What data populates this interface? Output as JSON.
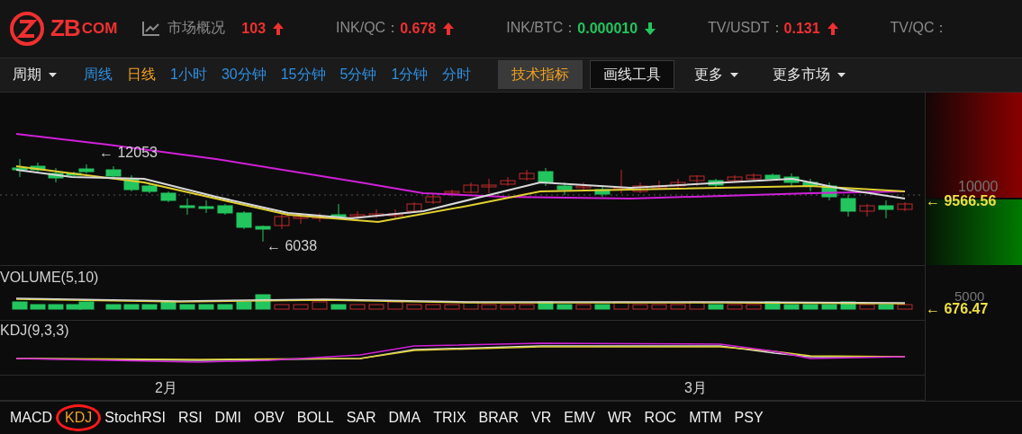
{
  "header": {
    "logo": {
      "mark": "ZB",
      "suffix": "COM"
    },
    "overview": {
      "label": "市场概况",
      "value": "103",
      "rising": true
    },
    "tickers": [
      {
        "pair": "INK/QC：",
        "price": "0.678",
        "rising": true
      },
      {
        "pair": "INK/BTC：",
        "price": "0.000010",
        "rising": false
      },
      {
        "pair": "TV/USDT：",
        "price": "0.131",
        "rising": true
      },
      {
        "pair": "TV/QC："
      }
    ]
  },
  "toolbar": {
    "period_menu": "周期",
    "intervals": [
      {
        "label": "周线",
        "selected": false
      },
      {
        "label": "日线",
        "selected": true
      },
      {
        "label": "1小时",
        "selected": false
      },
      {
        "label": "30分钟",
        "selected": false
      },
      {
        "label": "15分钟",
        "selected": false
      },
      {
        "label": "5分钟",
        "selected": false
      },
      {
        "label": "1分钟",
        "selected": false
      },
      {
        "label": "分时",
        "selected": false
      }
    ],
    "buttons": [
      {
        "label": "技术指标",
        "selected": true
      },
      {
        "label": "画线工具",
        "selected": false
      }
    ],
    "menus": [
      "更多",
      "更多市场"
    ]
  },
  "chart": {
    "high_label": "← 12053",
    "low_label": "← 6038",
    "price_axis": "10000",
    "current_price": "← 9566.56",
    "volume_title": "VOLUME(5,10)",
    "volume_axis": "5000",
    "current_volume": "← 676.47",
    "kdj_title": "KDJ(9,3,3)",
    "months": [
      "2月",
      "3月"
    ]
  },
  "indicators": [
    {
      "label": "MACD",
      "selected": false,
      "circled": false
    },
    {
      "label": "KDJ",
      "selected": true,
      "circled": true
    },
    {
      "label": "StochRSI",
      "selected": false,
      "circled": false
    },
    {
      "label": "RSI",
      "selected": false,
      "circled": false
    },
    {
      "label": "DMI",
      "selected": false,
      "circled": false
    },
    {
      "label": "OBV",
      "selected": false,
      "circled": false
    },
    {
      "label": "BOLL",
      "selected": false,
      "circled": false
    },
    {
      "label": "SAR",
      "selected": false,
      "circled": false
    },
    {
      "label": "DMA",
      "selected": false,
      "circled": false
    },
    {
      "label": "TRIX",
      "selected": false,
      "circled": false
    },
    {
      "label": "BRAR",
      "selected": false,
      "circled": false
    },
    {
      "label": "VR",
      "selected": false,
      "circled": false
    },
    {
      "label": "EMV",
      "selected": false,
      "circled": false
    },
    {
      "label": "WR",
      "selected": false,
      "circled": false
    },
    {
      "label": "ROC",
      "selected": false,
      "circled": false
    },
    {
      "label": "MTM",
      "selected": false,
      "circled": false
    },
    {
      "label": "PSY",
      "selected": false,
      "circled": false
    }
  ]
}
